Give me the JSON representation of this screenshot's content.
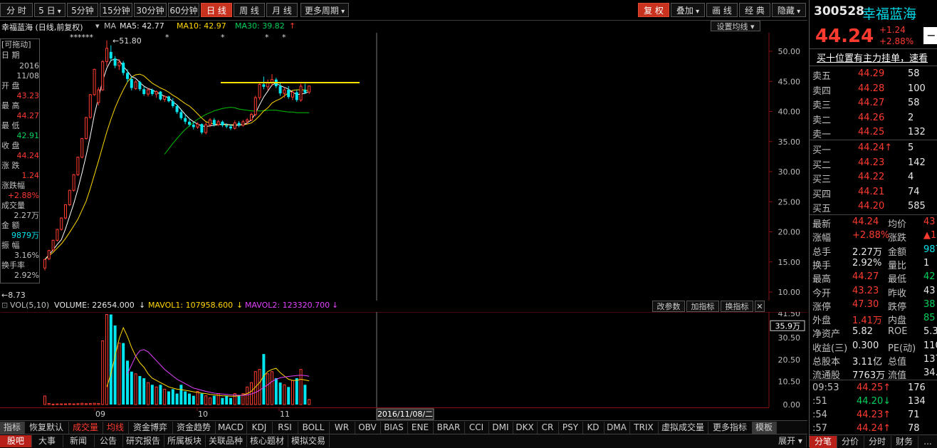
{
  "colors": {
    "up": "#ff3b30",
    "down": "#00e5ee",
    "ma5": "#ffffff",
    "ma10": "#ffd700",
    "ma30": "#00c000",
    "mavol2": "#e040fb",
    "yellow_line": "#ffe000",
    "gray_text": "#c0c0c0"
  },
  "toolbar": {
    "periods": [
      "分 时",
      "5 日",
      "5分钟",
      "15分钟",
      "30分钟",
      "60分钟",
      "日 线",
      "周 线",
      "月 线",
      "更多周期"
    ],
    "active_period": "日 线",
    "right_buttons": [
      "复 权",
      "叠加",
      "画 线",
      "经 典",
      "隐藏"
    ]
  },
  "legend": {
    "stock_title": "幸福蓝海 (日线,前复权)",
    "ma_label": "MA",
    "ma5": "MA5: 42.77",
    "ma10": "MA10: 42.97",
    "ma30": "MA30: 39.82",
    "set_ma": "设置均线"
  },
  "info_panel": {
    "header": "[可拖动]",
    "date_label": "日    期",
    "year": "2016",
    "date": "11/08",
    "open_label": "开    盘",
    "open": "43.23",
    "high_label": "最    高",
    "high": "44.27",
    "low_label": "最    低",
    "low": "42.91",
    "close_label": "收    盘",
    "close": "44.24",
    "change_label": "涨    跌",
    "change": "1.24",
    "pct_label": "涨跌幅",
    "pct": "+2.88%",
    "vol_label": "成交量",
    "vol": "2.27万",
    "amount_label": "金    额",
    "amount": "9879万",
    "amp_label": "振    幅",
    "amp": "3.16%",
    "turnover_label": "换手率",
    "turnover": "2.92%"
  },
  "price_axis": [
    "50.00",
    "45.00",
    "40.00",
    "35.00",
    "30.00",
    "25.00",
    "20.00",
    "15.00",
    "10.00"
  ],
  "annotations": {
    "high_mark": "51.80",
    "low_mark": "8.73",
    "stars": "******"
  },
  "volume": {
    "label": "VOL(5,10)",
    "volume": "VOLUME: 22654.000",
    "mavol1": "MAVOL1: 107958.600",
    "mavol2": "MAVOL2: 123320.700",
    "axis": [
      "41.50",
      "35.9万",
      "30.50",
      "20.50",
      "10.50",
      "0.00"
    ],
    "axis_note": "35.9万",
    "buttons": [
      "改参数",
      "加指标",
      "换指标",
      "✕"
    ]
  },
  "x_axis": {
    "labels": [
      "09",
      "10",
      "11"
    ],
    "cursor_date": "2016/11/08/二"
  },
  "indicators": [
    "指标",
    "恢复默认",
    "成交量",
    "均线",
    "资金博弈",
    "资金趋势",
    "MACD",
    "KDJ",
    "RSI",
    "BOLL",
    "WR",
    "OBV",
    "BIAS",
    "ENE",
    "BRAR",
    "CCI",
    "DMI",
    "DKX",
    "CR",
    "PSY",
    "KD",
    "DMA",
    "TRIX",
    "虚拟成交量",
    "更多指标",
    "模板"
  ],
  "bottom_tabs": [
    "股吧",
    "大事",
    "新闻",
    "公告",
    "研究报告",
    "所属板块",
    "关联品种",
    "核心题材",
    "模拟交易"
  ],
  "bottom_right": "展开",
  "right_panel": {
    "code": "300528",
    "name": "幸福蓝海",
    "price": "44.24",
    "change": "+1.24",
    "pct": "+2.88%",
    "notice": "买十位置有主力挂单，速看",
    "asks": [
      {
        "label": "卖五",
        "price": "44.29",
        "vol": "58"
      },
      {
        "label": "卖四",
        "price": "44.28",
        "vol": "100"
      },
      {
        "label": "卖三",
        "price": "44.27",
        "vol": "58"
      },
      {
        "label": "卖二",
        "price": "44.26",
        "vol": "2"
      },
      {
        "label": "卖一",
        "price": "44.25",
        "vol": "132"
      }
    ],
    "bids": [
      {
        "label": "买一",
        "price": "44.24↑",
        "vol": "5"
      },
      {
        "label": "买二",
        "price": "44.23",
        "vol": "142"
      },
      {
        "label": "买三",
        "price": "44.22",
        "vol": "4"
      },
      {
        "label": "买四",
        "price": "44.21",
        "vol": "74"
      },
      {
        "label": "买五",
        "price": "44.20",
        "vol": "585"
      }
    ],
    "stats": [
      {
        "l1": "最新",
        "v1": "44.24",
        "l2": "均价",
        "v2": "43"
      },
      {
        "l1": "涨幅",
        "v1": "+2.88%",
        "l2": "涨跌",
        "v2": "▲1"
      },
      {
        "l1": "总手",
        "v1": "2.27万",
        "l2": "金额",
        "v2": "987"
      },
      {
        "l1": "换手",
        "v1": "2.92%",
        "l2": "量比",
        "v2": "1"
      },
      {
        "l1": "最高",
        "v1": "44.27",
        "l2": "最低",
        "v2": "42"
      },
      {
        "l1": "今开",
        "v1": "43.23",
        "l2": "昨收",
        "v2": "43"
      },
      {
        "l1": "涨停",
        "v1": "47.30",
        "l2": "跌停",
        "v2": "38"
      },
      {
        "l1": "外盘",
        "v1": "1.41万",
        "l2": "内盘",
        "v2": "85"
      },
      {
        "l1": "净资产",
        "v1": "5.82",
        "l2": "ROE",
        "v2": "5.3"
      },
      {
        "l1": "收益(三)",
        "v1": "0.300",
        "l2": "PE(动)",
        "v2": "110"
      },
      {
        "l1": "总股本",
        "v1": "3.11亿",
        "l2": "总值",
        "v2": "137"
      },
      {
        "l1": "流通股",
        "v1": "7763万",
        "l2": "流值",
        "v2": "34.3"
      }
    ],
    "ticks": [
      {
        "time": "09:53",
        "price": "44.25↑",
        "vol": "176"
      },
      {
        "time": ":51",
        "price": "44.20↓",
        "vol": "134"
      },
      {
        "time": ":54",
        "price": "44.23↑",
        "vol": "71"
      },
      {
        "time": ":57",
        "price": "44.24↑",
        "vol": "78"
      }
    ],
    "tabs": [
      "分笔",
      "分价",
      "分时",
      "财务",
      "..."
    ]
  },
  "chart_data": {
    "type": "candlestick",
    "price_range": [
      10,
      52
    ],
    "candles": [
      [
        14.0,
        15.5,
        13.6,
        15.4
      ],
      [
        15.5,
        17.0,
        15.3,
        16.9
      ],
      [
        17.0,
        18.7,
        16.8,
        18.6
      ],
      [
        18.6,
        20.5,
        18.4,
        20.4
      ],
      [
        20.4,
        22.4,
        20.2,
        22.3
      ],
      [
        22.3,
        24.6,
        22.1,
        24.5
      ],
      [
        24.5,
        27.0,
        24.3,
        26.9
      ],
      [
        26.9,
        29.6,
        26.7,
        29.5
      ],
      [
        29.5,
        32.5,
        29.3,
        32.4
      ],
      [
        32.4,
        35.6,
        32.2,
        35.5
      ],
      [
        35.5,
        39.1,
        35.3,
        39.0
      ],
      [
        39.0,
        42.9,
        38.8,
        42.8
      ],
      [
        42.8,
        47.1,
        42.6,
        47.0
      ],
      [
        41.5,
        44.0,
        41.0,
        43.6
      ],
      [
        43.6,
        48.5,
        43.4,
        48.3
      ],
      [
        48.3,
        51.8,
        47.5,
        50.5
      ],
      [
        49.9,
        51.0,
        48.3,
        48.8
      ],
      [
        48.8,
        49.2,
        47.2,
        47.6
      ],
      [
        47.6,
        48.7,
        46.9,
        48.2
      ],
      [
        48.1,
        48.4,
        46.0,
        46.4
      ],
      [
        46.4,
        47.0,
        44.9,
        45.4
      ],
      [
        45.4,
        45.8,
        43.5,
        43.9
      ],
      [
        43.8,
        45.2,
        43.6,
        44.9
      ],
      [
        44.9,
        45.1,
        43.4,
        43.7
      ],
      [
        43.7,
        44.1,
        42.6,
        42.9
      ],
      [
        42.9,
        43.9,
        42.5,
        43.6
      ],
      [
        43.6,
        43.8,
        42.6,
        42.9
      ],
      [
        42.9,
        43.5,
        42.3,
        43.3
      ],
      [
        43.3,
        43.4,
        41.8,
        42.0
      ],
      [
        42.0,
        42.7,
        41.6,
        42.5
      ],
      [
        42.5,
        42.6,
        41.5,
        41.7
      ],
      [
        41.7,
        42.2,
        40.6,
        40.9
      ],
      [
        40.9,
        41.2,
        39.6,
        39.9
      ],
      [
        39.9,
        40.3,
        38.6,
        38.9
      ],
      [
        38.9,
        39.5,
        37.9,
        38.3
      ],
      [
        38.3,
        38.8,
        37.5,
        37.8
      ],
      [
        37.8,
        38.3,
        37.0,
        37.4
      ],
      [
        37.4,
        38.2,
        37.1,
        37.9
      ],
      [
        37.9,
        38.0,
        36.2,
        36.5
      ],
      [
        36.5,
        38.2,
        36.2,
        37.8
      ],
      [
        37.8,
        38.9,
        37.4,
        38.6
      ],
      [
        38.6,
        38.9,
        37.5,
        37.8
      ],
      [
        37.8,
        38.6,
        37.6,
        38.3
      ],
      [
        38.3,
        38.5,
        37.4,
        37.7
      ],
      [
        37.7,
        38.0,
        37.2,
        37.5
      ],
      [
        37.5,
        37.9,
        36.9,
        37.2
      ],
      [
        37.2,
        38.5,
        37.0,
        38.1
      ],
      [
        38.1,
        38.4,
        37.4,
        37.7
      ],
      [
        37.7,
        38.6,
        37.5,
        38.3
      ],
      [
        38.3,
        38.9,
        37.9,
        38.6
      ],
      [
        38.6,
        39.8,
        38.4,
        39.5
      ],
      [
        39.5,
        42.6,
        39.2,
        42.3
      ],
      [
        42.3,
        44.8,
        41.9,
        44.5
      ],
      [
        44.5,
        45.8,
        43.7,
        44.1
      ],
      [
        44.1,
        45.3,
        43.5,
        44.8
      ],
      [
        44.8,
        46.2,
        44.2,
        45.3
      ],
      [
        45.3,
        45.6,
        43.9,
        44.2
      ],
      [
        44.2,
        44.8,
        42.6,
        43.0
      ],
      [
        43.0,
        44.0,
        42.3,
        43.6
      ],
      [
        43.6,
        44.2,
        42.1,
        42.4
      ],
      [
        42.4,
        43.4,
        41.9,
        43.2
      ],
      [
        43.2,
        43.6,
        41.6,
        41.9
      ],
      [
        41.9,
        44.6,
        41.6,
        44.2
      ],
      [
        43.6,
        44.6,
        42.9,
        43.1
      ],
      [
        43.23,
        44.27,
        42.91,
        44.24
      ]
    ],
    "ma5": [
      15.4,
      16.2,
      17.0,
      17.9,
      18.7,
      20.5,
      22.6,
      24.7,
      27.1,
      29.8,
      32.7,
      35.9,
      39.5,
      42.3,
      45.1,
      47.2,
      48.5,
      48.7,
      48.5,
      47.5,
      46.7,
      45.8,
      45.5,
      44.8,
      44.2,
      43.8,
      43.6,
      43.2,
      42.9,
      42.5,
      42.3,
      41.6,
      41.1,
      40.3,
      39.5,
      38.8,
      38.3,
      37.9,
      37.6,
      37.5,
      37.6,
      37.7,
      37.8,
      37.9,
      37.9,
      37.7,
      37.7,
      37.7,
      37.8,
      38.1,
      38.6,
      39.7,
      41.1,
      42.4,
      43.4,
      44.4,
      44.7,
      44.3,
      44.0,
      43.7,
      43.2,
      42.8,
      42.9,
      43.0,
      43.3
    ],
    "ma10": [
      15.4,
      16.0,
      16.6,
      17.3,
      18.0,
      18.9,
      19.9,
      21.0,
      22.1,
      23.6,
      25.1,
      27.2,
      29.5,
      31.8,
      34.2,
      36.6,
      38.7,
      40.6,
      42.2,
      43.6,
      44.9,
      45.7,
      46.1,
      46.2,
      45.9,
      45.3,
      44.7,
      44.3,
      43.9,
      43.6,
      43.2,
      42.7,
      42.3,
      41.8,
      41.3,
      40.9,
      40.3,
      39.6,
      38.9,
      38.3,
      38.1,
      37.9,
      37.9,
      37.8,
      37.8,
      37.8,
      37.8,
      37.8,
      37.8,
      37.9,
      38.1,
      38.6,
      39.3,
      40.1,
      40.6,
      41.4,
      41.8,
      42.1,
      42.6,
      43.1,
      43.5,
      43.6,
      43.6,
      43.6,
      43.4
    ],
    "ma30": [
      null,
      null,
      null,
      null,
      null,
      null,
      null,
      null,
      null,
      null,
      null,
      null,
      null,
      null,
      null,
      null,
      null,
      null,
      null,
      null,
      null,
      null,
      null,
      null,
      null,
      null,
      null,
      null,
      null,
      32.9,
      33.8,
      34.7,
      35.5,
      36.3,
      37.0,
      37.6,
      38.2,
      38.7,
      39.1,
      39.5,
      39.8,
      40.1,
      40.3,
      40.5,
      40.6,
      40.7,
      40.6,
      40.4,
      40.3,
      40.2,
      40.1,
      40.1,
      40.1,
      40.1,
      40.2,
      40.2,
      40.2,
      40.1,
      40.0,
      39.9,
      39.9,
      39.8,
      39.8,
      39.8,
      39.8
    ],
    "yellow_level": 44.8,
    "volume_range": [
      0,
      41.5
    ],
    "volume_units": "万",
    "volume": [
      3.9,
      0.5,
      0.2,
      0.3,
      0.3,
      0.3,
      0.4,
      0.3,
      0.4,
      0.6,
      0.4,
      0.5,
      0.6,
      0.5,
      29.0,
      41.0,
      41.0,
      36.0,
      28.0,
      28.0,
      20.0,
      15.0,
      14.0,
      13.0,
      12.0,
      10.0,
      9.0,
      8.0,
      9.0,
      7.0,
      6.0,
      7.0,
      5.0,
      9.0,
      6.0,
      5.0,
      4.0,
      6.0,
      5.0,
      4.0,
      3.0,
      4.0,
      5.0,
      3.0,
      4.0,
      3.0,
      5.0,
      4.0,
      5.0,
      8.0,
      10.0,
      15.0,
      16.0,
      23.0,
      14.0,
      15.0,
      12.0,
      10.0,
      9.0,
      8.0,
      11.0,
      12.0,
      16.0,
      9.0,
      2.3
    ],
    "mavol1": [
      null,
      null,
      null,
      null,
      null,
      null,
      null,
      null,
      null,
      null,
      null,
      null,
      null,
      null,
      null,
      8.0,
      14.0,
      22.0,
      30.0,
      35.0,
      31.0,
      26.0,
      22.0,
      19.0,
      17.0,
      14.0,
      12.0,
      11.0,
      10.0,
      9.0,
      8.0,
      7.5,
      7.0,
      6.8,
      6.5,
      6.2,
      5.8,
      5.5,
      5.2,
      5.0,
      4.6,
      4.4,
      4.2,
      4.0,
      4.0,
      3.8,
      3.8,
      4.0,
      4.4,
      5.0,
      6.0,
      8.0,
      10.0,
      13.0,
      15.0,
      16.0,
      16.5,
      14.5,
      13.0,
      11.5,
      11.0,
      11.0,
      11.5,
      11.2,
      10.8
    ],
    "mavol2": [
      null,
      null,
      null,
      null,
      null,
      null,
      null,
      null,
      null,
      null,
      null,
      null,
      null,
      null,
      null,
      null,
      null,
      null,
      null,
      null,
      14.0,
      18.0,
      22.0,
      24.5,
      25.0,
      24.0,
      22.0,
      20.0,
      18.0,
      16.0,
      14.5,
      13.0,
      11.5,
      10.5,
      9.5,
      8.5,
      7.5,
      7.0,
      6.5,
      6.0,
      5.6,
      5.2,
      5.0,
      4.8,
      4.6,
      4.4,
      4.3,
      4.2,
      4.2,
      4.4,
      4.8,
      5.5,
      6.5,
      7.8,
      9.0,
      10.5,
      11.5,
      12.2,
      12.5,
      12.8,
      13.0,
      13.2,
      13.4,
      13.2,
      12.9
    ]
  }
}
